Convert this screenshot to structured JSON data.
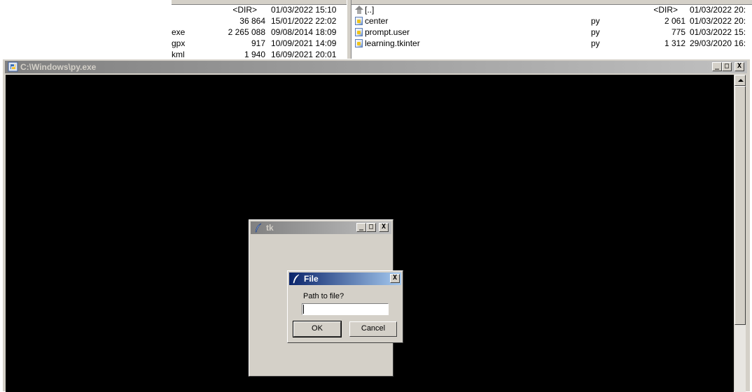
{
  "left_panel": {
    "rows": [
      {
        "ext": "",
        "size": "<DIR>",
        "date": "01/03/2022 15:10"
      },
      {
        "ext": "",
        "size": "36 864",
        "date": "15/01/2022 22:02"
      },
      {
        "ext": "exe",
        "size": "2 265 088",
        "date": "09/08/2014 18:09"
      },
      {
        "ext": "gpx",
        "size": "917",
        "date": "10/09/2021 14:09"
      },
      {
        "ext": "kml",
        "size": "1 940",
        "date": "16/09/2021 20:01"
      }
    ]
  },
  "right_panel": {
    "rows": [
      {
        "name": "[..]",
        "ext": "",
        "size": "<DIR>",
        "date": "01/03/2022 20:",
        "icon": "up-dir-icon"
      },
      {
        "name": "center",
        "ext": "py",
        "size": "2 061",
        "date": "01/03/2022 20:",
        "icon": "python-file-icon"
      },
      {
        "name": "prompt.user",
        "ext": "py",
        "size": "775",
        "date": "01/03/2022 15:",
        "icon": "python-file-icon"
      },
      {
        "name": "learning.tkinter",
        "ext": "py",
        "size": "1 312",
        "date": "29/03/2020 16:",
        "icon": "python-file-icon"
      }
    ]
  },
  "console": {
    "title": "C:\\Windows\\py.exe",
    "minimize": "_",
    "maximize": "□",
    "close": "X"
  },
  "tk_window": {
    "title": "tk",
    "minimize": "_",
    "maximize": "□",
    "close": "X"
  },
  "dialog": {
    "title": "File",
    "close": "X",
    "prompt": "Path to file?",
    "input_value": "",
    "ok_label": "OK",
    "cancel_label": "Cancel"
  },
  "colors": {
    "active_title_start": "#0a246a",
    "active_title_end": "#a6caf0",
    "inactive_title_start": "#808080",
    "inactive_title_end": "#c0c0c0",
    "face": "#d4d0c8",
    "console_bg": "#000000"
  }
}
